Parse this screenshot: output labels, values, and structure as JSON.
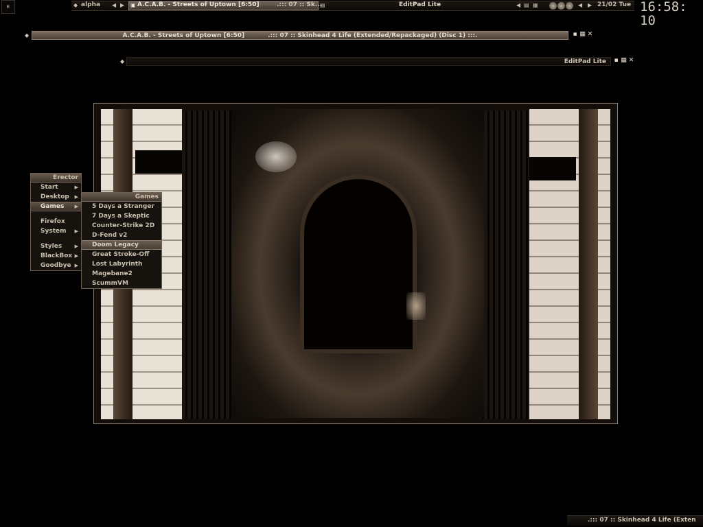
{
  "toolbar": {
    "menu_corner_label": "E",
    "workspace": "alpha",
    "tasks": [
      {
        "label": "A.C.A.B. - Streets of Uptown [6:50]"
      },
      {
        "label": ".::: 07 :: Sk..."
      }
    ],
    "center_title": "EditPad Lite",
    "date": "21/02 Tue",
    "clock": "16:58: 10"
  },
  "windows": [
    {
      "title": "A.C.A.B. - Streets of Uptown [6:50]",
      "subtitle": ".::: 07 :: Skinhead 4 Life (Extended/Repackaged) (Disc 1) :::."
    },
    {
      "title": "EditPad Lite"
    }
  ],
  "root_menu": {
    "title": "Erector",
    "items": [
      {
        "label": "Start",
        "submenu": true
      },
      {
        "label": "Desktop",
        "submenu": true
      },
      {
        "label": "Games",
        "submenu": true,
        "active": true
      },
      {
        "label": "Firefox",
        "submenu": false
      },
      {
        "label": "System",
        "submenu": true
      },
      {
        "label": "Styles",
        "submenu": true
      },
      {
        "label": "BlackBox",
        "submenu": true
      },
      {
        "label": "Goodbye",
        "submenu": true
      }
    ]
  },
  "games_menu": {
    "title": "Games",
    "items": [
      {
        "label": "5 Days a Stranger"
      },
      {
        "label": "7 Days a Skeptic"
      },
      {
        "label": "Counter-Strike 2D"
      },
      {
        "label": "D-Fend v2"
      },
      {
        "label": "Doom Legacy",
        "highlighted": true
      },
      {
        "label": "Great Stroke-Off"
      },
      {
        "label": "Lost Labyrinth"
      },
      {
        "label": "Magebane2"
      },
      {
        "label": "ScummVM"
      }
    ]
  },
  "bottom_bar": {
    "label": ".::: 07 :: Skinhead 4 Life (Exten"
  },
  "colors": {
    "accent": "#7c6e60",
    "text": "#c9bfae",
    "background": "#000000"
  }
}
